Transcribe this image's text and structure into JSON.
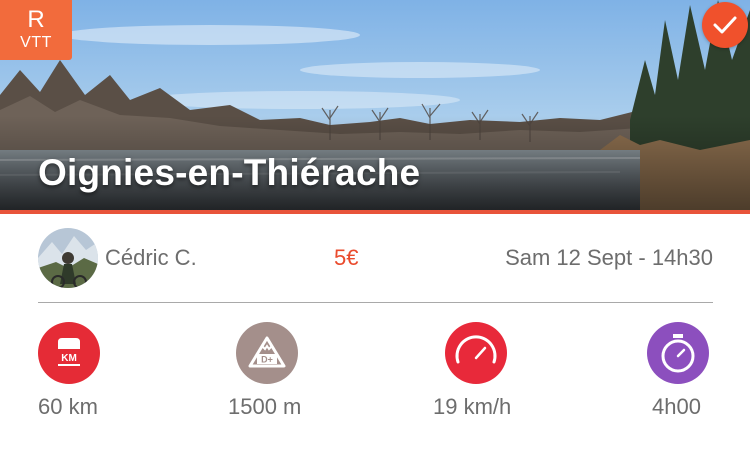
{
  "badge": {
    "letter": "R",
    "label": "VTT"
  },
  "hero": {
    "title": "Oignies-en-Thiérache"
  },
  "ride": {
    "organizer": "Cédric C.",
    "price": "5€",
    "date": "Sam 12 Sept - 14h30"
  },
  "icons": {
    "distance_text": "KM",
    "elevation_text": "D+"
  },
  "stats": {
    "distance": "60 km",
    "elevation": "1500 m",
    "speed": "19 km/h",
    "duration": "4h00"
  },
  "colors": {
    "accent": "#e8543a",
    "badge": "#f26b3c",
    "price": "#ea4b2d",
    "distance_icon": "#e52b36",
    "elevation_icon": "#a48f8b",
    "speed_icon": "#e8293a",
    "duration_icon": "#8c4fbe",
    "text_gray": "#6d6d6d"
  }
}
